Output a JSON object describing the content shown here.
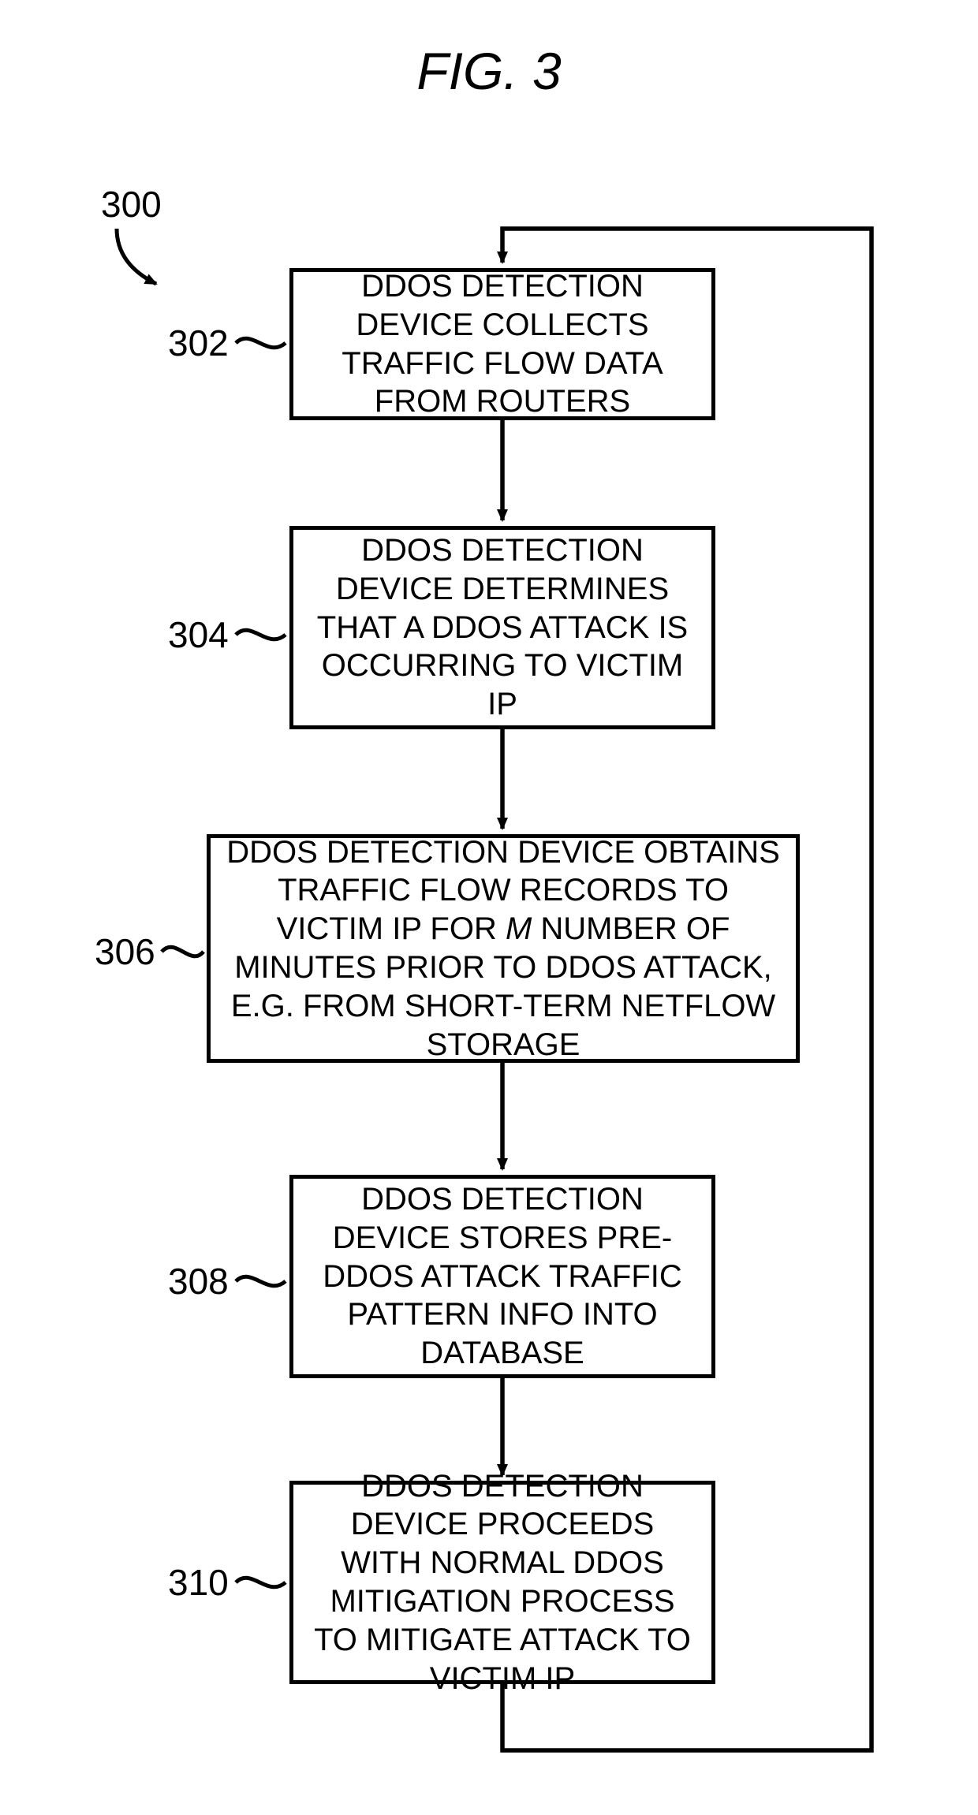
{
  "figure": {
    "title": "FIG. 3",
    "ref_main": "300",
    "steps": [
      {
        "ref": "302",
        "text": "DDOS DETECTION DEVICE COLLECTS TRAFFIC FLOW DATA FROM ROUTERS"
      },
      {
        "ref": "304",
        "text": "DDOS DETECTION DEVICE DETERMINES THAT A DDOS ATTACK IS OCCURRING TO VICTIM IP"
      },
      {
        "ref": "306",
        "text_pre": "DDOS DETECTION DEVICE OBTAINS TRAFFIC FLOW RECORDS TO VICTIM IP FOR ",
        "text_italic": "M",
        "text_post": " NUMBER OF MINUTES PRIOR TO DDOS ATTACK, E.G. FROM SHORT-TERM NETFLOW STORAGE"
      },
      {
        "ref": "308",
        "text": "DDOS DETECTION DEVICE STORES PRE-DDOS ATTACK TRAFFIC PATTERN INFO INTO DATABASE"
      },
      {
        "ref": "310",
        "text": "DDOS DETECTION DEVICE PROCEEDS WITH NORMAL DDOS MITIGATION PROCESS TO MITIGATE ATTACK TO VICTIM IP"
      }
    ]
  },
  "chart_data": {
    "type": "flowchart",
    "title": "FIG. 3",
    "ref": "300",
    "nodes": [
      {
        "id": "302",
        "label": "DDOS DETECTION DEVICE COLLECTS TRAFFIC FLOW DATA FROM ROUTERS"
      },
      {
        "id": "304",
        "label": "DDOS DETECTION DEVICE DETERMINES THAT A DDOS ATTACK IS OCCURRING TO VICTIM IP"
      },
      {
        "id": "306",
        "label": "DDOS DETECTION DEVICE OBTAINS TRAFFIC FLOW RECORDS TO VICTIM IP FOR M NUMBER OF MINUTES PRIOR TO DDOS ATTACK, E.G. FROM SHORT-TERM NETFLOW STORAGE"
      },
      {
        "id": "308",
        "label": "DDOS DETECTION DEVICE STORES PRE-DDOS ATTACK TRAFFIC PATTERN INFO INTO DATABASE"
      },
      {
        "id": "310",
        "label": "DDOS DETECTION DEVICE PROCEEDS WITH NORMAL DDOS MITIGATION PROCESS TO MITIGATE ATTACK TO VICTIM IP"
      }
    ],
    "edges": [
      {
        "from": "302",
        "to": "304"
      },
      {
        "from": "304",
        "to": "306"
      },
      {
        "from": "306",
        "to": "308"
      },
      {
        "from": "308",
        "to": "310"
      },
      {
        "from": "310",
        "to": "302",
        "loop": true
      }
    ]
  }
}
